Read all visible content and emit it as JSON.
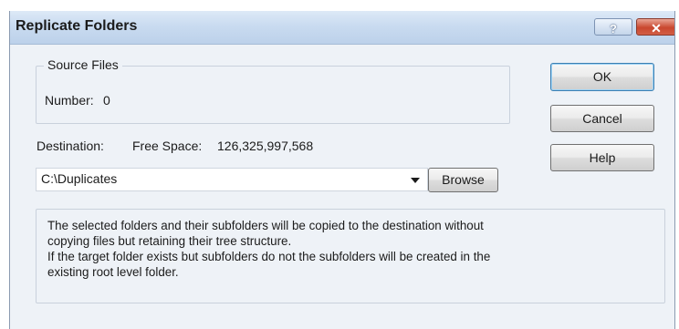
{
  "window": {
    "title": "Replicate Folders",
    "help_glyph": "?",
    "close_glyph": "✕"
  },
  "source_files": {
    "caption": "Source Files",
    "number_label": "Number:",
    "number_value": "0"
  },
  "destination": {
    "label": "Destination:",
    "free_space_label": "Free Space:",
    "free_space_value": "126,325,997,568",
    "path_value": "C:\\Duplicates"
  },
  "buttons": {
    "ok": "OK",
    "cancel": "Cancel",
    "help": "Help",
    "browse": "Browse"
  },
  "info": {
    "lines": [
      "The selected folders and their subfolders will be copied to the destination without",
      "copying files but retaining their tree structure.",
      "If the target folder exists but subfolders do not the subfolders will be created in the",
      "existing root level folder."
    ]
  },
  "icons": {
    "help": "help-icon",
    "close": "close-icon",
    "dropdown": "chevron-down-icon"
  }
}
